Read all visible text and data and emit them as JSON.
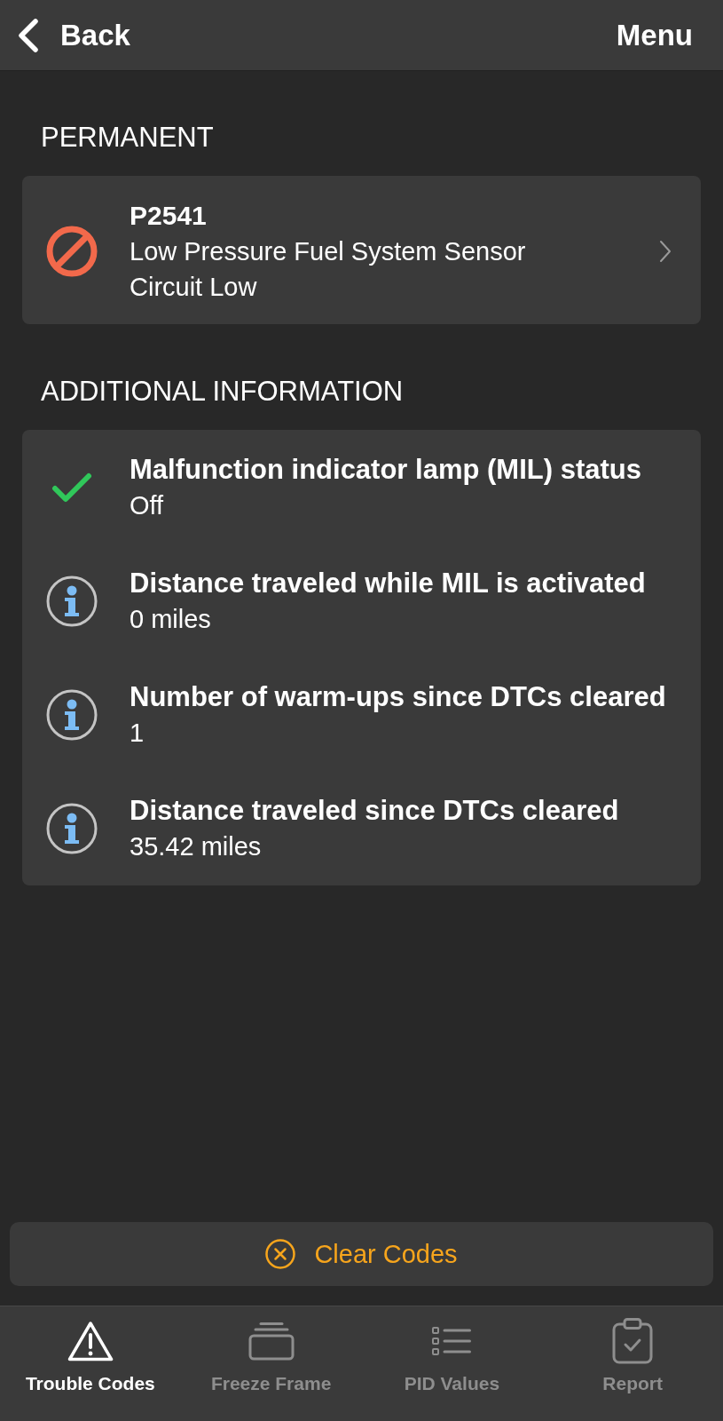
{
  "nav_bar": {
    "back_label": "Back",
    "menu_label": "Menu"
  },
  "permanent": {
    "heading": "PERMANENT",
    "codes": [
      {
        "code": "P2541",
        "description": "Low Pressure Fuel System Sensor Circuit Low"
      }
    ]
  },
  "additional_information": {
    "heading": "ADDITIONAL INFORMATION",
    "items": [
      {
        "kind": "ok",
        "label": "Malfunction indicator lamp (MIL) status",
        "value": "Off"
      },
      {
        "kind": "info",
        "label": "Distance traveled while MIL is activated",
        "value": "0 miles"
      },
      {
        "kind": "info",
        "label": "Number of warm-ups since DTCs cleared",
        "value": "1"
      },
      {
        "kind": "info",
        "label": "Distance traveled since DTCs cleared",
        "value": "35.42 miles"
      }
    ]
  },
  "clear_button": {
    "label": "Clear Codes"
  },
  "tab_bar": {
    "tabs": [
      {
        "label": "Trouble Codes",
        "selected": true
      },
      {
        "label": "Freeze Frame",
        "selected": false
      },
      {
        "label": "PID Values",
        "selected": false
      },
      {
        "label": "Report",
        "selected": false
      }
    ]
  }
}
